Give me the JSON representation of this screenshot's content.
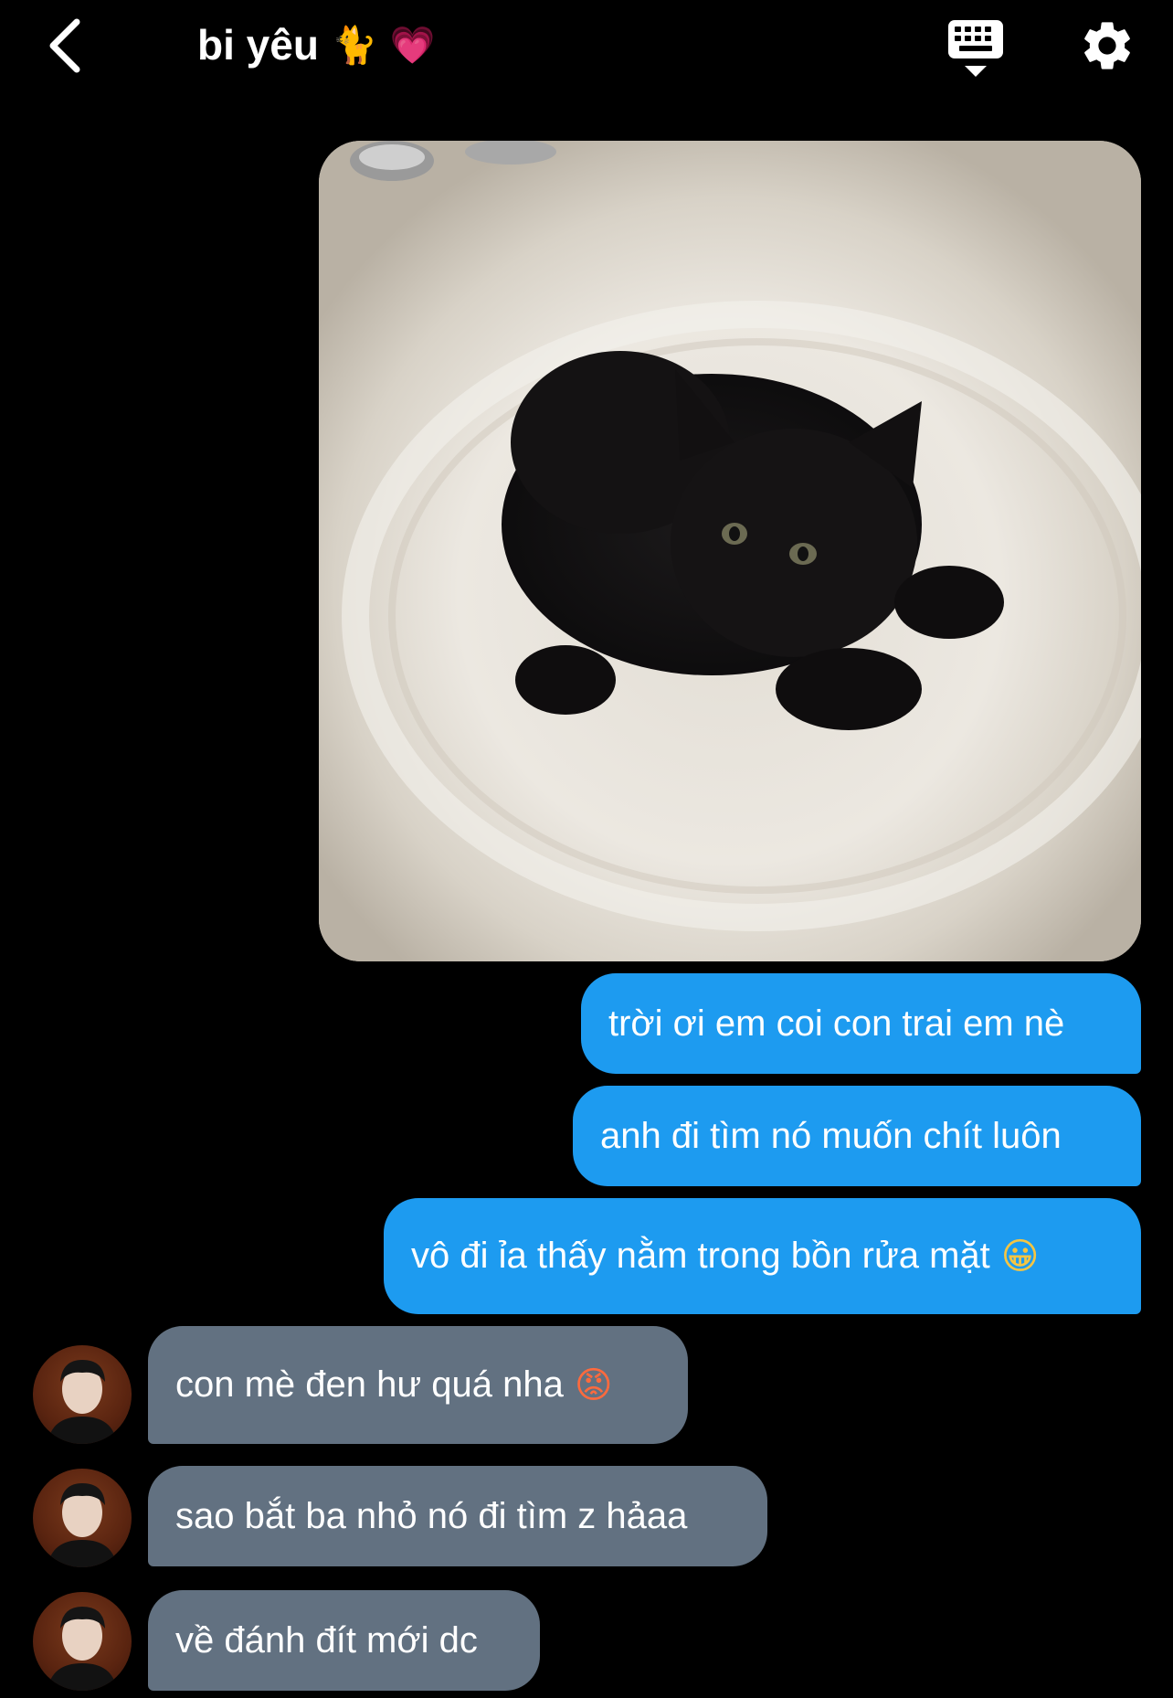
{
  "header": {
    "title": "bi yêu",
    "title_emoji_1": "🐈",
    "title_emoji_2": "💗",
    "icons": {
      "back": "chevron-left-icon",
      "keyboard": "keyboard-icon",
      "settings": "gear-icon"
    }
  },
  "messages": [
    {
      "type": "image",
      "side": "out",
      "alt": "black kitten in a white sink"
    },
    {
      "type": "text",
      "side": "out",
      "text": "trời ơi em coi con trai em nè"
    },
    {
      "type": "text",
      "side": "out",
      "text": "anh đi tìm nó muốn chít luôn"
    },
    {
      "type": "text",
      "side": "out",
      "text": "vô đi ỉa thấy nằm trong bồn rửa mặt",
      "emoji": "😀"
    },
    {
      "type": "text",
      "side": "in",
      "text": "con mè đen hư quá nha",
      "emoji": "😡"
    },
    {
      "type": "text",
      "side": "in",
      "text": "sao bắt ba nhỏ nó đi tìm z hảaa"
    },
    {
      "type": "text",
      "side": "in",
      "text": "về đánh đít mới dc"
    }
  ],
  "colors": {
    "background": "#000000",
    "outgoing_bubble": "#1d9bf0",
    "incoming_bubble": "#627181",
    "text": "#ffffff"
  }
}
